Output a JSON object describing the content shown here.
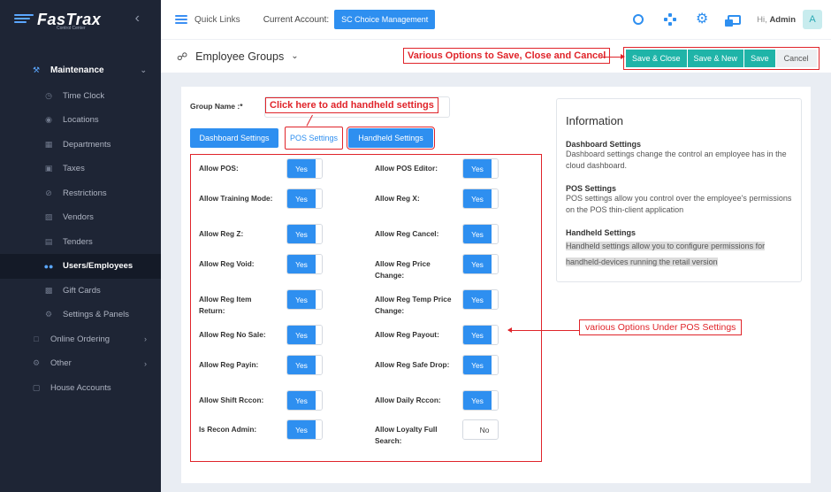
{
  "app": {
    "logo_text": "FasTrax",
    "logo_sub": "Control Center"
  },
  "sidebar": {
    "items": [
      {
        "label": "Maintenance",
        "icon": "wrench-icon",
        "kind": "parent"
      },
      {
        "label": "Time Clock",
        "icon": "clock-icon",
        "kind": "sub"
      },
      {
        "label": "Locations",
        "icon": "map-pin-icon",
        "kind": "sub"
      },
      {
        "label": "Departments",
        "icon": "building-icon",
        "kind": "sub"
      },
      {
        "label": "Taxes",
        "icon": "receipt-icon",
        "kind": "sub"
      },
      {
        "label": "Restrictions",
        "icon": "ban-icon",
        "kind": "sub"
      },
      {
        "label": "Vendors",
        "icon": "truck-icon",
        "kind": "sub"
      },
      {
        "label": "Tenders",
        "icon": "cash-icon",
        "kind": "sub"
      },
      {
        "label": "Users/Employees",
        "icon": "users-icon",
        "kind": "active"
      },
      {
        "label": "Gift Cards",
        "icon": "gift-icon",
        "kind": "sub"
      },
      {
        "label": "Settings & Panels",
        "icon": "gear-icon",
        "kind": "sub"
      },
      {
        "label": "Online Ordering",
        "icon": "cart-icon",
        "kind": "top"
      },
      {
        "label": "Other",
        "icon": "cogs-icon",
        "kind": "top"
      },
      {
        "label": "House Accounts",
        "icon": "wallet-icon",
        "kind": "top"
      }
    ]
  },
  "topbar": {
    "quick_links": "Quick Links",
    "current_account_label": "Current Account:",
    "current_account_value": "SC Choice Management",
    "greeting": "Hi,",
    "user": "Admin",
    "avatar_letter": "A"
  },
  "subheader": {
    "title": "Employee Groups",
    "annotation": "Various Options to Save, Close and Cancel",
    "buttons": {
      "save_close": "Save & Close",
      "save_new": "Save & New",
      "save": "Save",
      "cancel": "Cancel"
    }
  },
  "form": {
    "group_name_label": "Group Name :*",
    "group_name_value": "",
    "annotation_click": "Click here to add handheld settings",
    "tabs": {
      "dashboard": "Dashboard Settings",
      "pos": "POS Settings",
      "handheld": "Handheld Settings"
    },
    "pos_options": [
      {
        "label": "Allow POS:",
        "value": "Yes"
      },
      {
        "label": "Allow POS Editor:",
        "value": "Yes"
      },
      {
        "label": "Allow Training Mode:",
        "value": "Yes"
      },
      {
        "label": "Allow Reg X:",
        "value": "Yes"
      },
      {
        "label": "Allow Reg Z:",
        "value": "Yes"
      },
      {
        "label": "Allow Reg Cancel:",
        "value": "Yes"
      },
      {
        "label": "Allow Reg Void:",
        "value": "Yes"
      },
      {
        "label": "Allow Reg Price Change:",
        "value": "Yes"
      },
      {
        "label": "Allow Reg Item Return:",
        "value": "Yes"
      },
      {
        "label": "Allow Reg Temp Price Change:",
        "value": "Yes"
      },
      {
        "label": "Allow Reg No Sale:",
        "value": "Yes"
      },
      {
        "label": "Allow Reg Payout:",
        "value": "Yes"
      },
      {
        "label": "Allow Reg Payin:",
        "value": "Yes"
      },
      {
        "label": "Allow Reg Safe Drop:",
        "value": "Yes"
      },
      {
        "label": "Allow Shift Rccon:",
        "value": "Yes"
      },
      {
        "label": "Allow Daily Rccon:",
        "value": "Yes"
      },
      {
        "label": "Is Recon Admin:",
        "value": "Yes"
      },
      {
        "label": "Allow Loyalty Full Search:",
        "value": "No"
      }
    ],
    "annotation_pos": "various Options Under POS Settings"
  },
  "info": {
    "title": "Information",
    "sections": [
      {
        "heading": "Dashboard Settings",
        "text": "Dashboard settings change the control an employee has in the cloud dashboard."
      },
      {
        "heading": "POS Settings",
        "text": "POS settings allow you control over the employee's permissions on the POS thin-client application"
      },
      {
        "heading": "Handheld Settings",
        "text": "Handheld settings allow you to configure permissions for handheld-devices running the retail version"
      }
    ]
  },
  "colors": {
    "accent": "#2e8ff0",
    "save_green": "#1fb4a8",
    "annotation_red": "#e0242a",
    "sidebar_bg": "#1e2535"
  }
}
